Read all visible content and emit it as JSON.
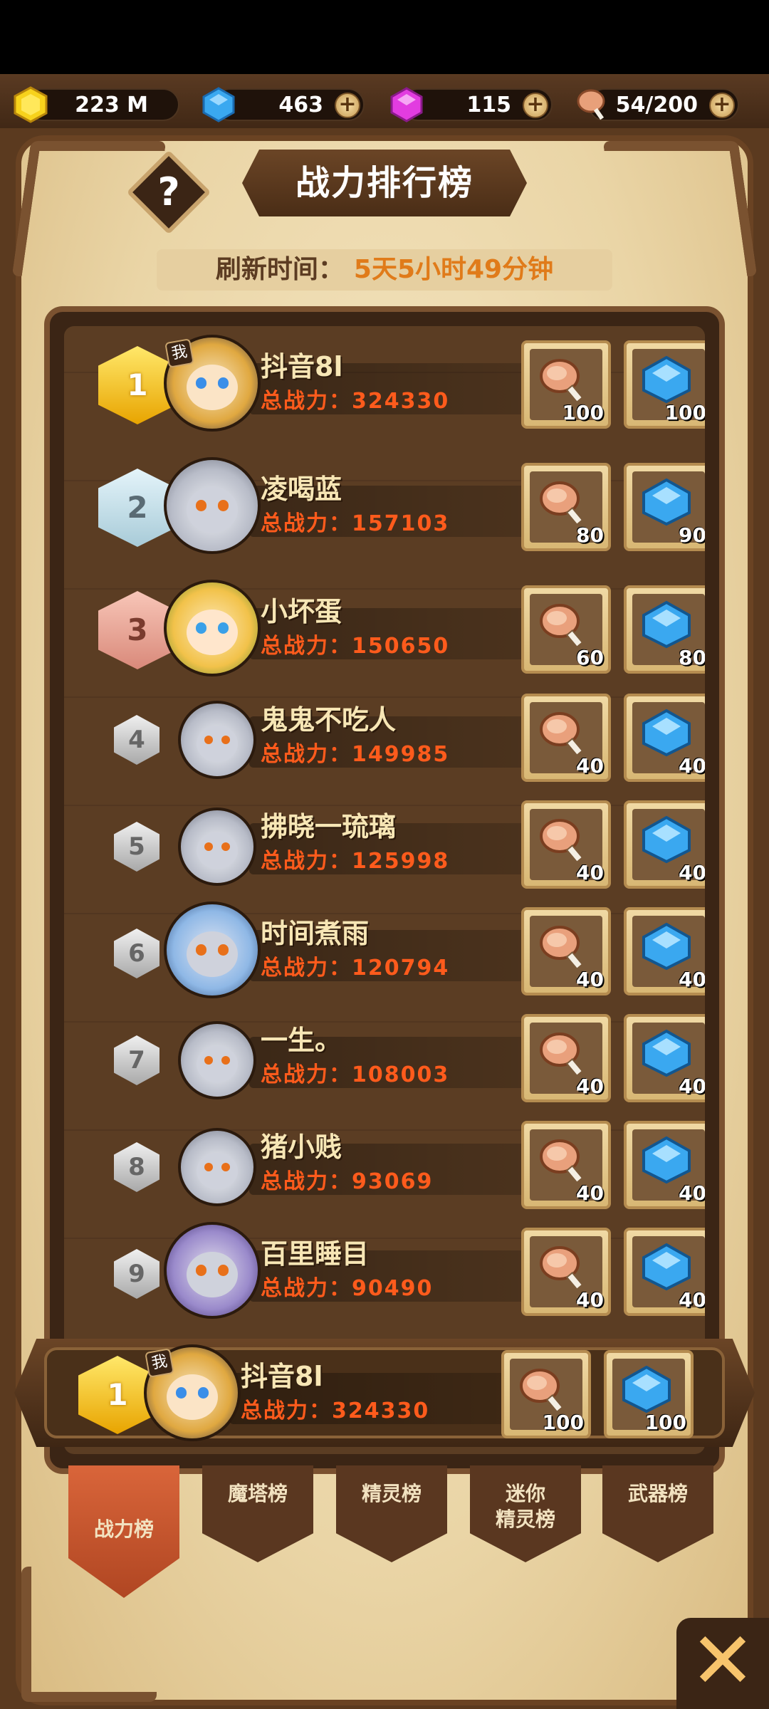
{
  "currency": {
    "gold": "223 M",
    "diamond": "463",
    "crystal": "115",
    "stamina": "54/200",
    "plus_label": "+"
  },
  "header": {
    "title": "战力排行榜",
    "help_label": "?",
    "refresh_label": "刷新时间：",
    "refresh_time": "5天5小时49分钟"
  },
  "rows": [
    {
      "rank": "1",
      "name": "抖音8l",
      "power": "总战力：324330",
      "meat": "100",
      "gem": "100"
    },
    {
      "rank": "2",
      "name": "凌喝蓝",
      "power": "总战力：157103",
      "meat": "80",
      "gem": "90"
    },
    {
      "rank": "3",
      "name": "小坏蛋",
      "power": "总战力：150650",
      "meat": "60",
      "gem": "80"
    },
    {
      "rank": "4",
      "name": "鬼鬼不吃人",
      "power": "总战力：149985",
      "meat": "40",
      "gem": "40"
    },
    {
      "rank": "5",
      "name": "拂晓一琉璃",
      "power": "总战力：125998",
      "meat": "40",
      "gem": "40"
    },
    {
      "rank": "6",
      "name": "时间煮雨",
      "power": "总战力：120794",
      "meat": "40",
      "gem": "40"
    },
    {
      "rank": "7",
      "name": "一生。",
      "power": "总战力：108003",
      "meat": "40",
      "gem": "40"
    },
    {
      "rank": "8",
      "name": "猪小贱",
      "power": "总战力：93069",
      "meat": "40",
      "gem": "40"
    },
    {
      "rank": "9",
      "name": "百里睡目",
      "power": "总战力：90490",
      "meat": "40",
      "gem": "40"
    }
  ],
  "me": {
    "badge": "我",
    "rank": "1",
    "name": "抖音8l",
    "power": "总战力：324330",
    "meat": "100",
    "gem": "100"
  },
  "tabs": [
    {
      "label": "战力榜"
    },
    {
      "label": "魔塔榜"
    },
    {
      "label": "精灵榜"
    },
    {
      "label": "迷你\n精灵榜"
    },
    {
      "label": "武器榜"
    }
  ],
  "close_label": "✕",
  "colors": {
    "accent_orange": "#ff5b1c",
    "tab_active": "#c8552e",
    "gold": "#f7c46c"
  }
}
